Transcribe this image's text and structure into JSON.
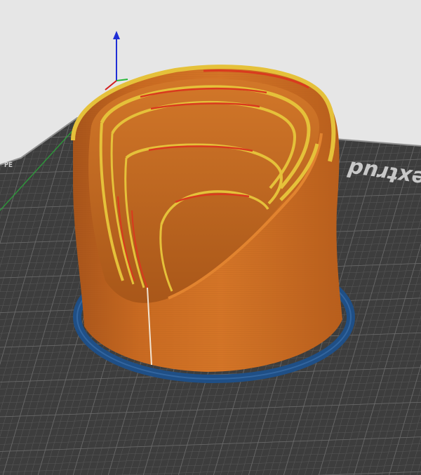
{
  "viewer": {
    "bed_brand_text": "extrud",
    "bed_badge_text": "PE",
    "colors": {
      "background": "#e6e6e6",
      "bed": "#3d3d3d",
      "bed_grid": "#5a5a5a",
      "bed_edge": "#8f8f8f",
      "print_body": "#c96a21",
      "print_shade": "#a6531a",
      "print_highlight": "#e1832f",
      "perimeter_yellow": "#e5c13a",
      "perimeter_red": "#d93a1e",
      "skirt_blue": "#1f4f86",
      "axis_x": "#d21f1f",
      "axis_y": "#29b83b",
      "axis_z": "#1f2fd6"
    },
    "icons": {
      "axis_gizmo": "axis-gizmo-icon",
      "bed_badge": "printer-badge-icon"
    }
  }
}
